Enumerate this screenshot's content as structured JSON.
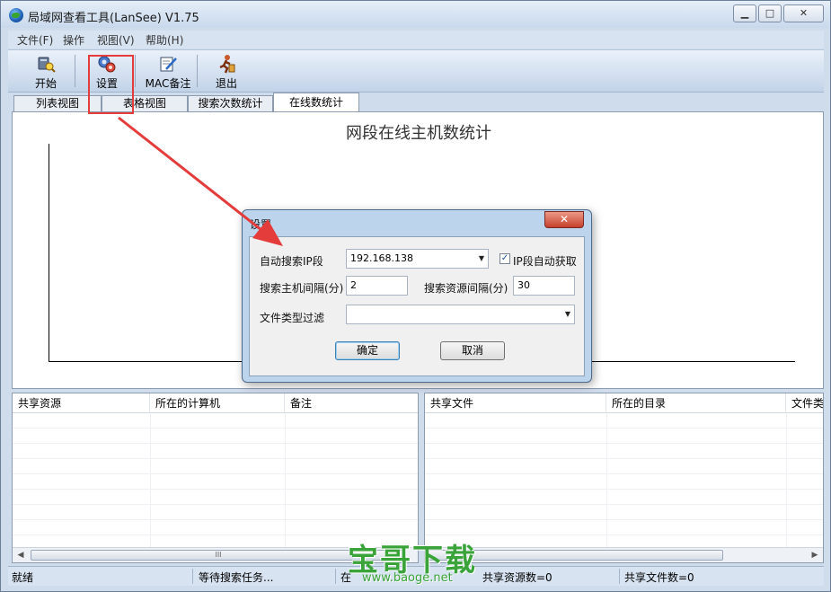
{
  "window": {
    "title": "局域网查看工具(LanSee) V1.75",
    "min_glyph": "▁",
    "max_glyph": "□",
    "close_glyph": "✕"
  },
  "menu": [
    "文件(F)",
    "操作",
    "视图(V)",
    "帮助(H)"
  ],
  "toolbar": {
    "start": "开始",
    "settings": "设置",
    "mac_note": "MAC备注",
    "exit": "退出"
  },
  "tabs": [
    "列表视图",
    "表格视图",
    "搜索次数统计",
    "在线数统计"
  ],
  "active_tab": 3,
  "chart": {
    "title": "网段在线主机数统计"
  },
  "left_list": {
    "columns": [
      "共享资源",
      "所在的计算机",
      "备注"
    ],
    "scroll_mark": "III"
  },
  "right_list": {
    "columns": [
      "共享文件",
      "所在的目录",
      "文件类"
    ]
  },
  "status": {
    "ready": "就绪",
    "waiting": "等待搜索任务...",
    "online_prefix": "在",
    "shared_resources": "共享资源数=0",
    "shared_files": "共享文件数=0"
  },
  "dialog": {
    "title": "设置",
    "close_glyph": "✕",
    "auto_ip_label": "自动搜索IP段",
    "ip_value": "192.168.138",
    "auto_get_label": "IP段自动获取",
    "auto_get_checked": true,
    "host_interval_label": "搜索主机间隔(分)",
    "host_interval_value": "2",
    "res_interval_label": "搜索资源间隔(分)",
    "res_interval_value": "30",
    "filter_label": "文件类型过滤",
    "filter_value": "",
    "ok": "确定",
    "cancel": "取消"
  },
  "watermark": {
    "main": "宝哥下载",
    "sub": "www.baoge.net"
  },
  "colors": {
    "accent_red": "#e43b3b",
    "watermark_green": "#3aa43a"
  }
}
